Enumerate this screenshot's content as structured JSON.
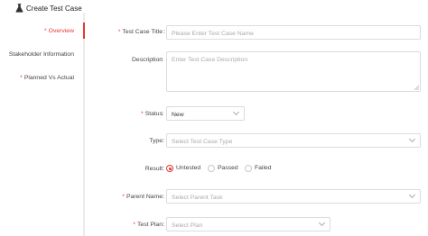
{
  "header": {
    "title": "Create Test Case",
    "icon": "flask-icon"
  },
  "sidebar": {
    "items": [
      {
        "label": "Overview",
        "required": true,
        "active": true
      },
      {
        "label": "Stakeholder Information",
        "required": false,
        "active": false
      },
      {
        "label": "Planned Vs Actual",
        "required": true,
        "active": false
      }
    ]
  },
  "form": {
    "title_field": {
      "label": "Test Case Title",
      "required": true,
      "placeholder": "Please Enter Test Case Name",
      "value": ""
    },
    "description": {
      "label": "Description",
      "required": false,
      "placeholder": "Enter Test Case Description",
      "value": ""
    },
    "status": {
      "label": "Status",
      "required": true,
      "value": "New"
    },
    "type": {
      "label": "Type",
      "required": false,
      "placeholder": "Select Test Case Type"
    },
    "result": {
      "label": "Result",
      "required": false,
      "options": [
        "Untested",
        "Passed",
        "Failed"
      ],
      "selected": "Untested"
    },
    "parent": {
      "label": "Parent Name",
      "required": true,
      "placeholder": "Select Parent Task"
    },
    "plan": {
      "label": "Test Plan",
      "required": true,
      "placeholder": "Select Plan"
    }
  },
  "colors": {
    "accent": "#e53935",
    "border": "#dcdcdc",
    "placeholder": "#aaaaaa"
  },
  "punctuation": {
    "required_mark": "*",
    "colon": ":"
  }
}
